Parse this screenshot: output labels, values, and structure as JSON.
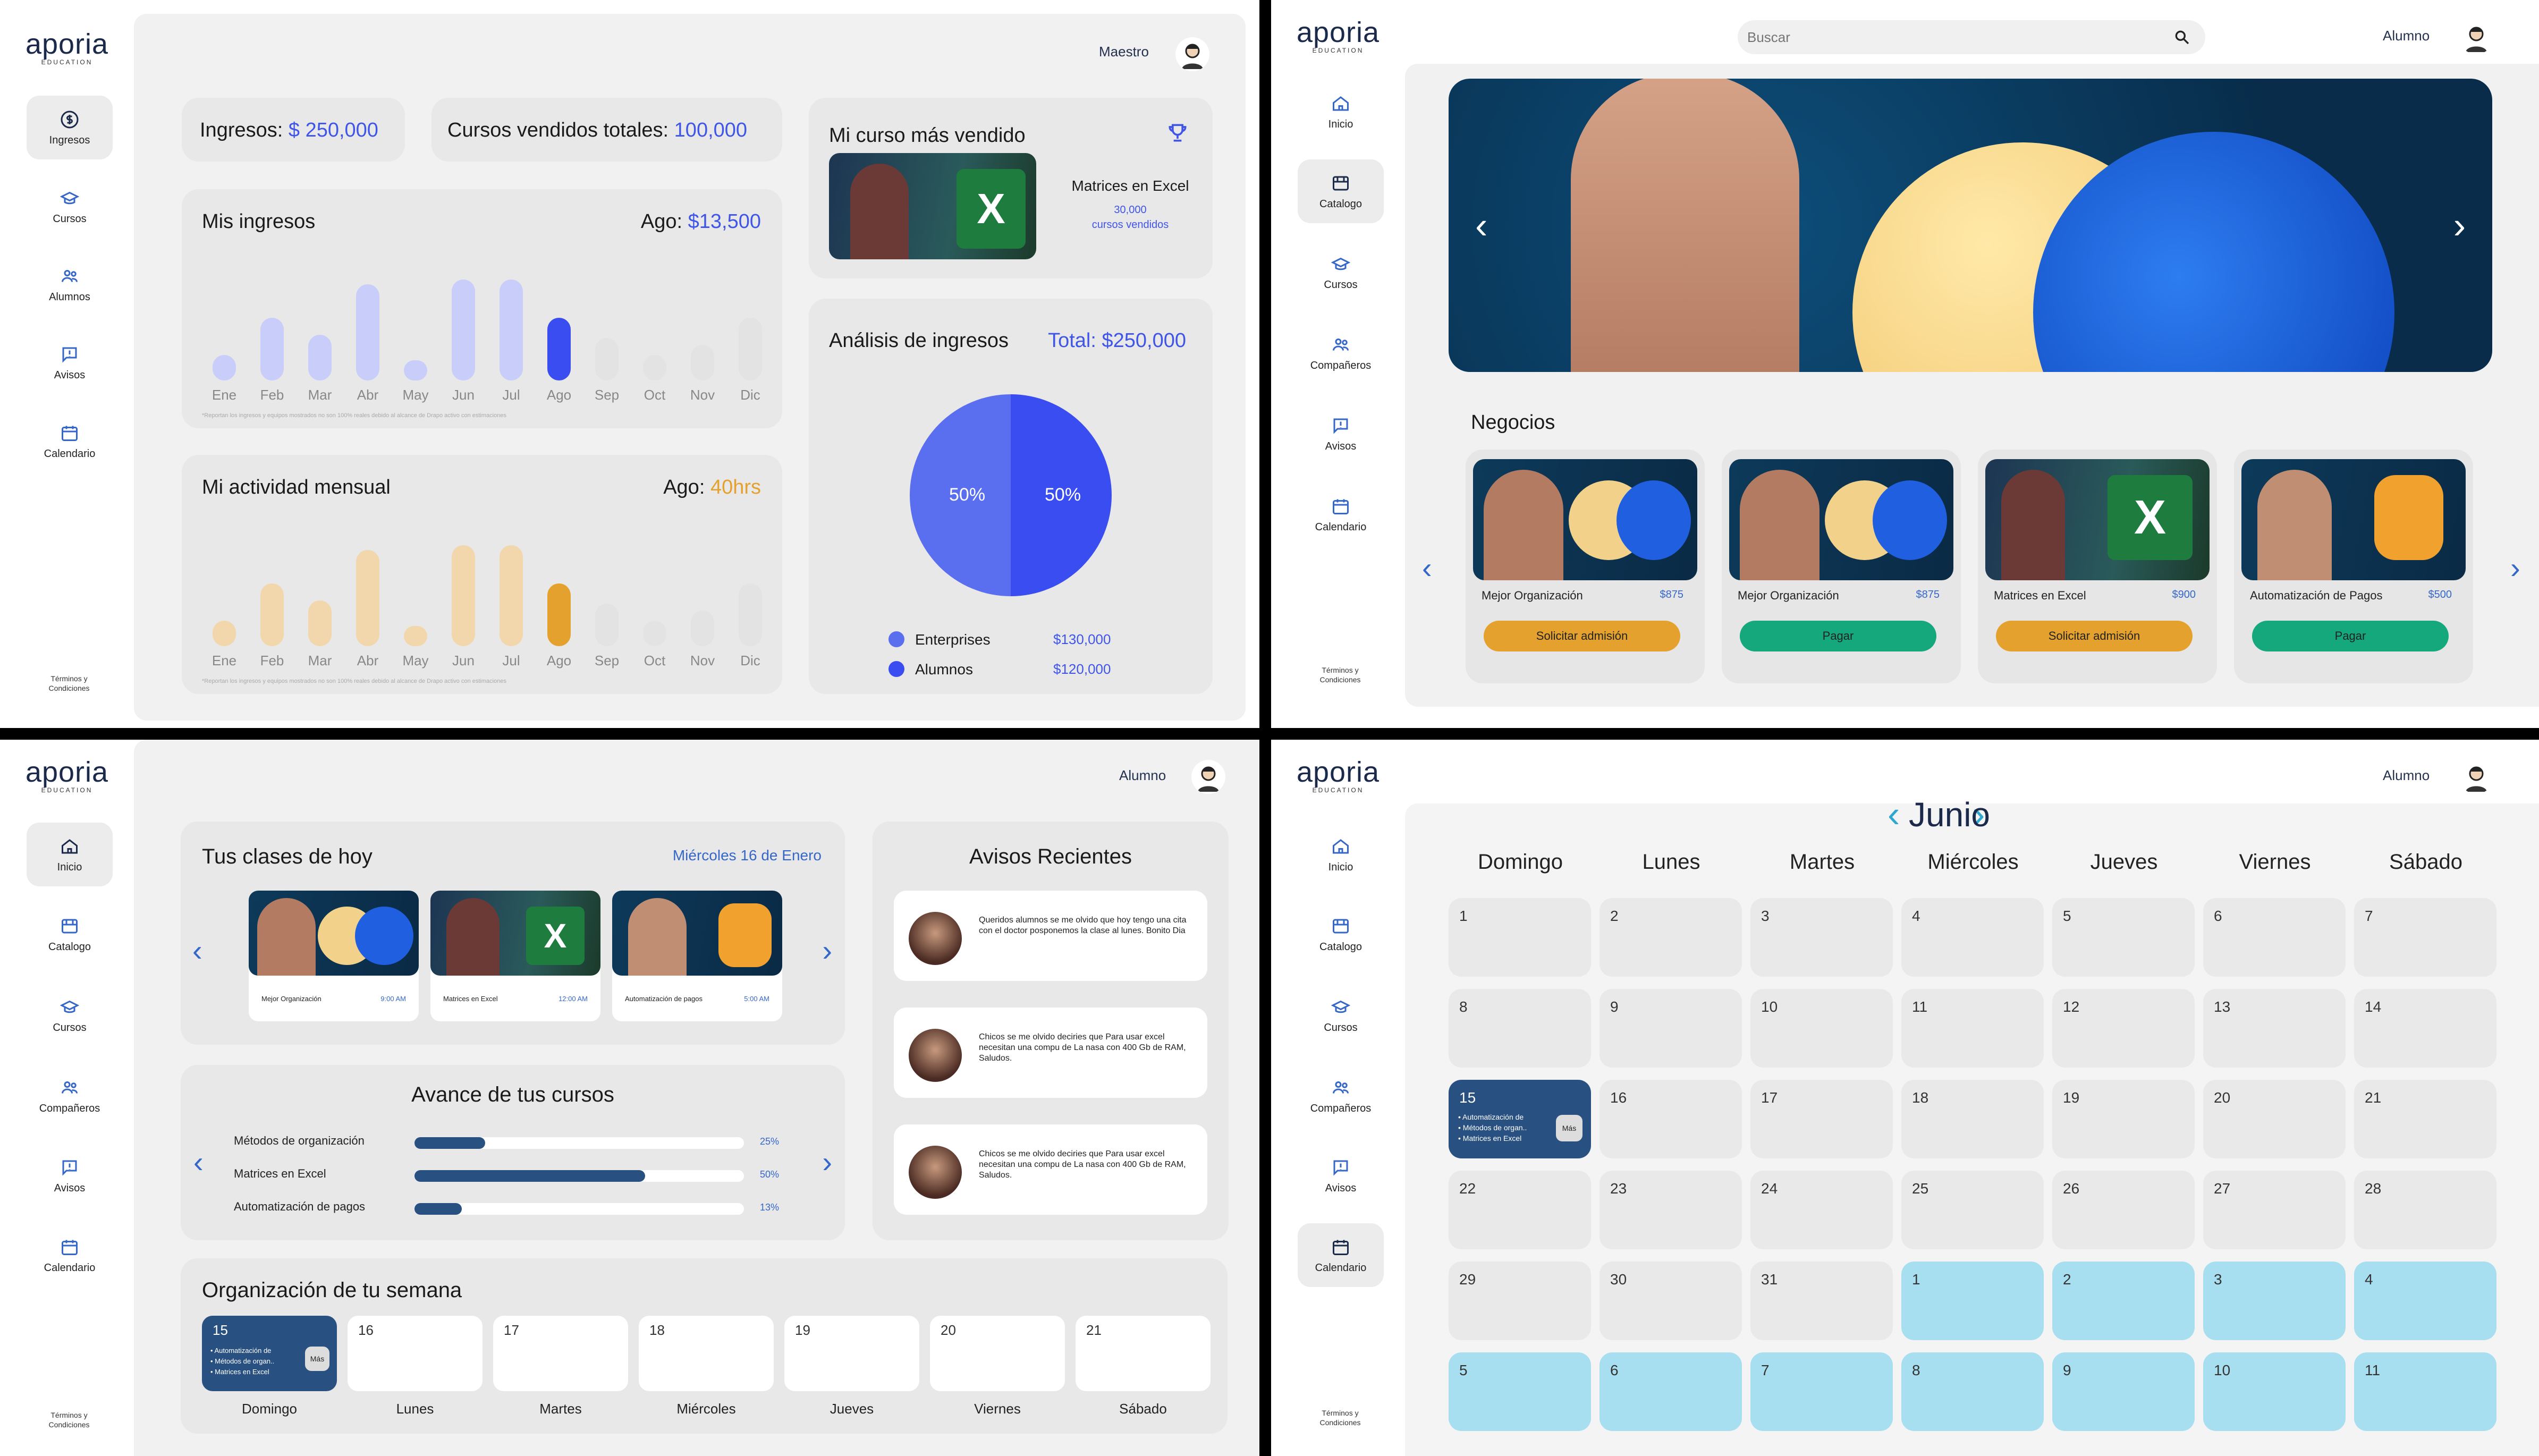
{
  "brand": {
    "name": "aporia",
    "sub": "EDUCATION"
  },
  "terms": "Términos y Condiciones",
  "colors": {
    "accent": "#3f55e8",
    "navy": "#285182",
    "orange": "#e5a12d",
    "teal": "#15a87c",
    "lightblue": "#a8dff0"
  },
  "dashboard": {
    "role": "Maestro",
    "nav": [
      {
        "icon": "dollar-icon",
        "label": "Ingresos"
      },
      {
        "icon": "graduation-cap-icon",
        "label": "Cursos"
      },
      {
        "icon": "users-icon",
        "label": "Alumnos"
      },
      {
        "icon": "message-icon",
        "label": "Avisos"
      },
      {
        "icon": "calendar-icon",
        "label": "Calendario"
      }
    ],
    "income_label": "Ingresos:",
    "income_value": "$ 250,000",
    "sold_label": "Cursos vendidos totales:",
    "sold_value": "100,000",
    "top_course_title": "Mi curso más vendido",
    "top_course_name": "Matrices en Excel",
    "top_course_count": "30,000",
    "top_course_unit": "cursos vendidos",
    "my_income_title": "Mis ingresos",
    "my_income_month": "Ago:",
    "my_income_value": "$13,500",
    "activity_title": "Mi actividad mensual",
    "activity_month": "Ago:",
    "activity_value": "40hrs",
    "analysis_title": "Análisis de ingresos",
    "analysis_total_label": "Total:",
    "analysis_total": "$250,000",
    "footnote": "*Reportan los ingresos y equipos mostrados no son 100% reales debido al alcance de Drapo activo con estimaciones",
    "months": [
      "Ene",
      "Feb",
      "Mar",
      "Abr",
      "May",
      "Jun",
      "Jul",
      "Ago",
      "Sep",
      "Oct",
      "Nov",
      "Dic"
    ],
    "income_levels": [
      0.25,
      0.62,
      0.45,
      0.95,
      0.2,
      1.0,
      1.0,
      0.62,
      0.42,
      0.25,
      0.35,
      0.62
    ],
    "activity_levels": [
      0.25,
      0.62,
      0.45,
      0.95,
      0.2,
      1.0,
      1.0,
      0.62,
      0.42,
      0.25,
      0.35,
      0.62
    ],
    "pie": {
      "slices": [
        {
          "name": "Enterprises",
          "value": "$130,000",
          "pct": "50%"
        },
        {
          "name": "Alumnos",
          "value": "$120,000",
          "pct": "50%"
        }
      ]
    }
  },
  "catalog": {
    "role": "Alumno",
    "search_placeholder": "Buscar",
    "nav": [
      {
        "icon": "home-icon",
        "label": "Inicio"
      },
      {
        "icon": "catalog-icon",
        "label": "Catalogo"
      },
      {
        "icon": "graduation-cap-icon",
        "label": "Cursos"
      },
      {
        "icon": "users-icon",
        "label": "Compañeros"
      },
      {
        "icon": "message-icon",
        "label": "Avisos"
      },
      {
        "icon": "calendar-icon",
        "label": "Calendario"
      }
    ],
    "section": "Negocios",
    "courses": [
      {
        "title": "Mejor Organización",
        "price": "$875",
        "button": "Solicitar admisión"
      },
      {
        "title": "Mejor Organización",
        "price": "$875",
        "button": "Pagar"
      },
      {
        "title": "Matrices en Excel",
        "price": "$900",
        "button": "Solicitar admisión"
      },
      {
        "title": "Automatización de Pagos",
        "price": "$500",
        "button": "Pagar"
      }
    ]
  },
  "home": {
    "role": "Alumno",
    "classes_title": "Tus clases de hoy",
    "date": "Miércoles 16 de Enero",
    "classes": [
      {
        "title": "Mejor Organización",
        "time": "9:00 AM"
      },
      {
        "title": "Matrices en Excel",
        "time": "12:00 AM"
      },
      {
        "title": "Automatización de pagos",
        "time": "5:00 AM"
      }
    ],
    "progress_title": "Avance de tus cursos",
    "progress": [
      {
        "name": "Métodos de organización",
        "pct": "25%",
        "value": 0.25
      },
      {
        "name": "Matrices en Excel",
        "pct": "50%",
        "value": 0.5
      },
      {
        "name": "Automatización de pagos",
        "pct": "13%",
        "value": 0.13
      }
    ],
    "notices_title": "Avisos Recientes",
    "notices": [
      "Queridos alumnos se me olvido que hoy tengo una cita con el doctor posponemos la clase al lunes. Bonito Dia",
      "Chicos se me olvido deciries que Para usar excel necesitan una compu de La nasa con 400 Gb de RAM, Saludos.",
      "Chicos se me olvido deciries que Para usar excel necesitan una compu de La nasa con 400 Gb de RAM, Saludos."
    ],
    "week_title": "Organización de tu semana",
    "week": [
      {
        "n": "15",
        "d": "Domingo"
      },
      {
        "n": "16",
        "d": "Lunes"
      },
      {
        "n": "17",
        "d": "Martes"
      },
      {
        "n": "18",
        "d": "Miércoles"
      },
      {
        "n": "19",
        "d": "Jueves"
      },
      {
        "n": "20",
        "d": "Viernes"
      },
      {
        "n": "21",
        "d": "Sábado"
      }
    ],
    "today_items": [
      "• Automatización de",
      "• Métodos de organ..",
      "• Matrices en Excel"
    ],
    "more": "Más"
  },
  "calendar": {
    "role": "Alumno",
    "month": "Junio",
    "days": [
      "Domingo",
      "Lunes",
      "Martes",
      "Miércoles",
      "Jueves",
      "Viernes",
      "Sábado"
    ],
    "cells": [
      "1",
      "2",
      "3",
      "4",
      "5",
      "6",
      "7",
      "8",
      "9",
      "10",
      "11",
      "12",
      "13",
      "14",
      "15",
      "16",
      "17",
      "18",
      "19",
      "20",
      "21",
      "22",
      "23",
      "24",
      "25",
      "26",
      "27",
      "28",
      "29",
      "30",
      "31",
      "1",
      "2",
      "3",
      "4",
      "5",
      "6",
      "7",
      "8",
      "9",
      "10",
      "11"
    ],
    "today_items": [
      "• Automatización de",
      "• Métodos de organ..",
      "• Matrices en Excel"
    ],
    "more": "Más"
  }
}
